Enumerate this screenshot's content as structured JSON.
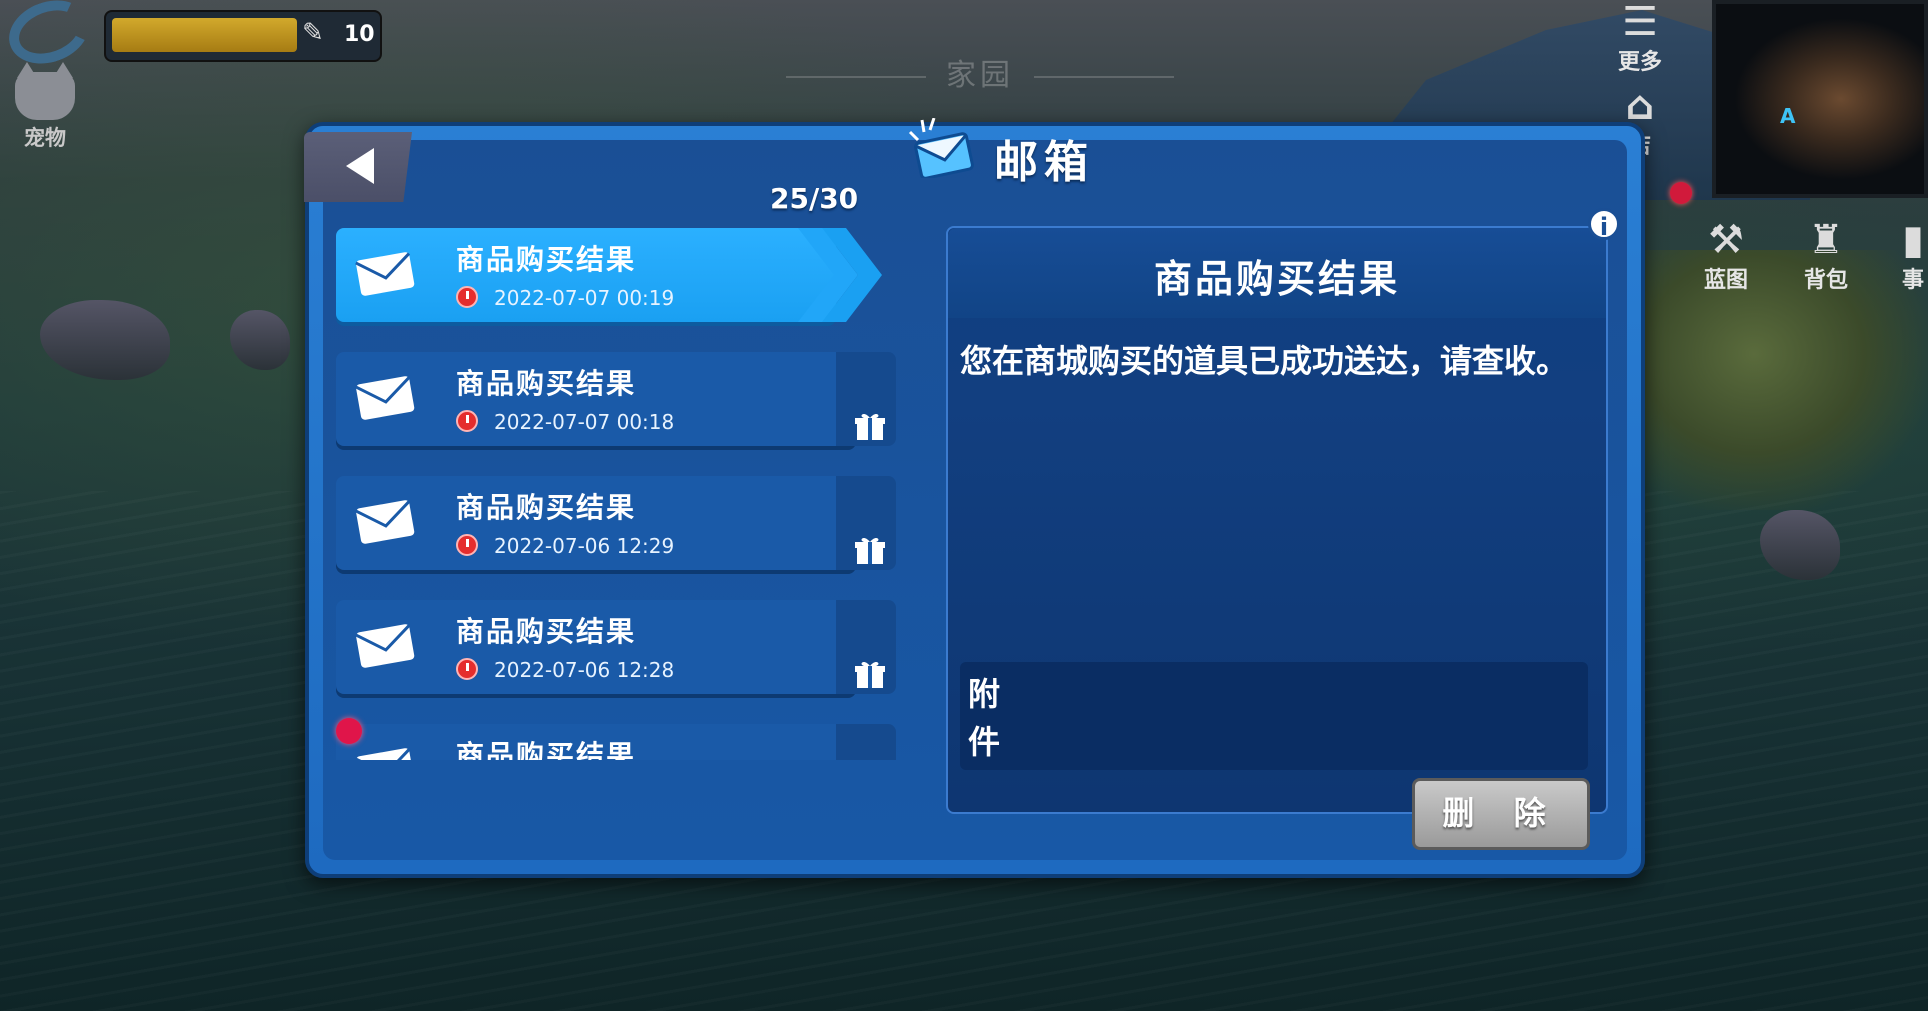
{
  "hud": {
    "feather_count": "10",
    "pet_label": "宠物",
    "zone_title": "家园",
    "more_label": "更多",
    "shop_label_partial": "店",
    "blueprint_label": "蓝图",
    "backpack_label": "背包",
    "partial_right_label": "事",
    "minimap_marker": "A"
  },
  "mailbox": {
    "title": "邮箱",
    "count": "25/30",
    "items": [
      {
        "title": "商品购买结果",
        "time": "2022-07-07 00:19"
      },
      {
        "title": "商品购买结果",
        "time": "2022-07-07 00:18"
      },
      {
        "title": "商品购买结果",
        "time": "2022-07-06 12:29"
      },
      {
        "title": "商品购买结果",
        "time": "2022-07-06 12:28"
      },
      {
        "title": "商品购买结果",
        "time": ""
      }
    ],
    "detail": {
      "title": "商品购买结果",
      "body": "您在商城购买的道具已成功送达，请查收。",
      "attachment_label": "附件",
      "delete_label": "删 除",
      "info_symbol": "i"
    }
  },
  "colors": {
    "panel_blue": "#1e6ac0",
    "active_item": "#1aa0f2",
    "unread_dot": "#e0154a"
  }
}
